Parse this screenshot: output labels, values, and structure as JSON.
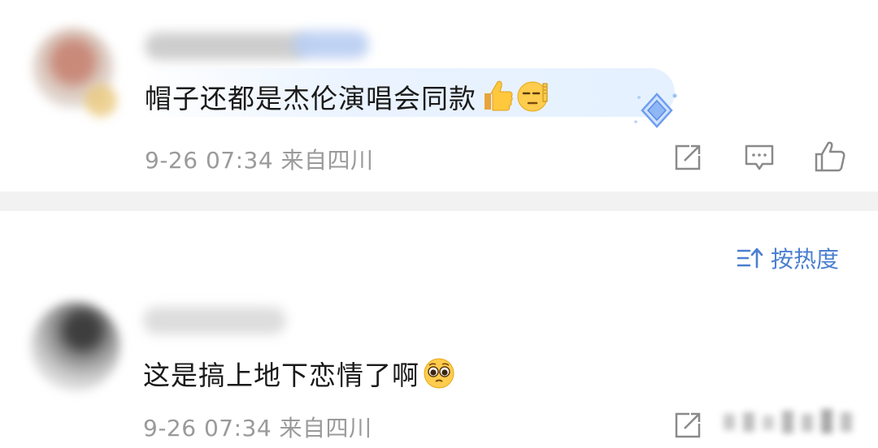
{
  "comments": [
    {
      "text": "帽子还都是杰伦演唱会同款",
      "emojis": [
        "thumbs-up",
        "salute-face"
      ],
      "time": "9-26 07:34",
      "location": "来自四川",
      "actions": [
        "share-icon",
        "comment-icon",
        "like-icon"
      ]
    },
    {
      "text": "这是搞上地下恋情了啊",
      "emojis": [
        "pleading-face"
      ],
      "time": "9-26 07:34",
      "location": "来自四川",
      "actions": [
        "share-icon"
      ]
    }
  ],
  "sort": {
    "label": "按热度",
    "icon": "sort-icon"
  },
  "colors": {
    "accent": "#4a7fd0",
    "meta": "#9a9a9a",
    "separator": "#f2f2f2"
  }
}
